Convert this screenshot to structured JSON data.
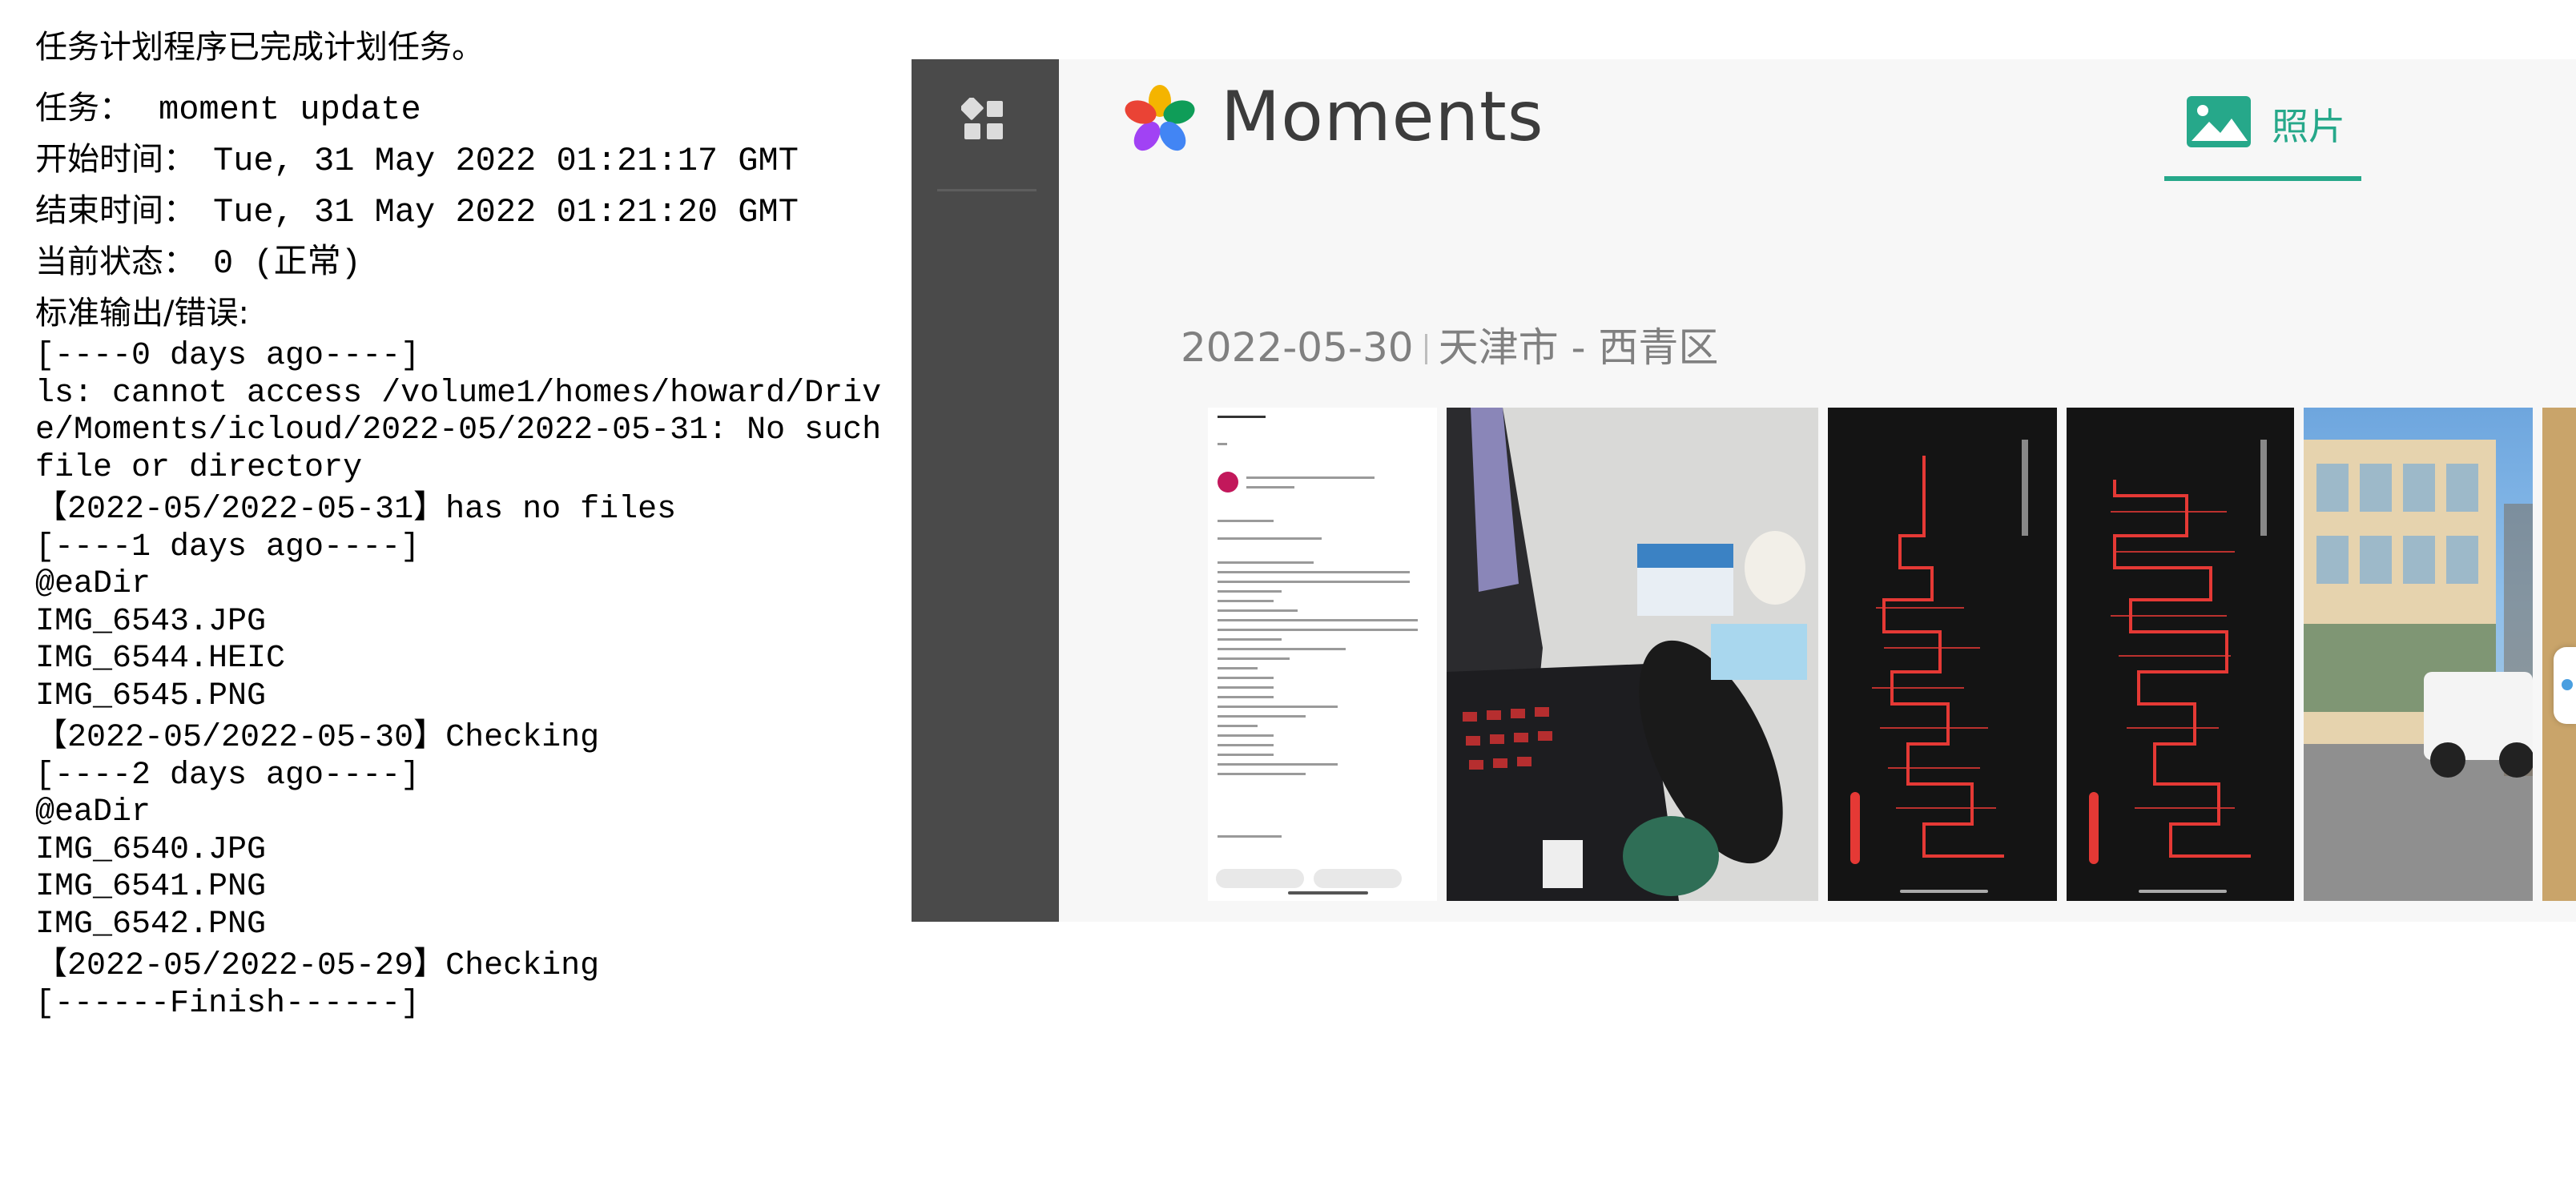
{
  "email": {
    "intro": "任务计划程序已完成计划任务。",
    "task_label": "任务：",
    "task_value": "moment update",
    "start_label": "开始时间：",
    "start_value": "Tue, 31 May 2022 01:21:17 GMT",
    "end_label": "结束时间：",
    "end_value": "Tue, 31 May 2022 01:21:20 GMT",
    "status_label": "当前状态：",
    "status_value": "0 (正常)",
    "stdout_label": "标准输出/错误:",
    "log_lines": [
      "[----0 days ago----]",
      "ls: cannot access /volume1/homes/howard/Drive/Moments/icloud/2022-05/2022-05-31: No such file or directory",
      "【2022-05/2022-05-31】has no files",
      "[----1 days ago----]",
      "@eaDir",
      "IMG_6543.JPG",
      "IMG_6544.HEIC",
      "IMG_6545.PNG",
      "【2022-05/2022-05-30】Checking",
      "[----2 days ago----]",
      "@eaDir",
      "IMG_6540.JPG",
      "IMG_6541.PNG",
      "IMG_6542.PNG",
      "【2022-05/2022-05-29】Checking",
      "[------Finish------]"
    ]
  },
  "moments": {
    "app_title": "Moments",
    "tab_photos": "照片",
    "date": "2022-05-30",
    "location": "天津市 - 西青区",
    "accent_color": "#26a88a",
    "sidebar_icon": "grid-icon",
    "photos": [
      {
        "id": "email-screenshot"
      },
      {
        "id": "laptop-desk"
      },
      {
        "id": "chart-screenshot-1"
      },
      {
        "id": "chart-screenshot-2"
      },
      {
        "id": "building-car"
      }
    ]
  }
}
